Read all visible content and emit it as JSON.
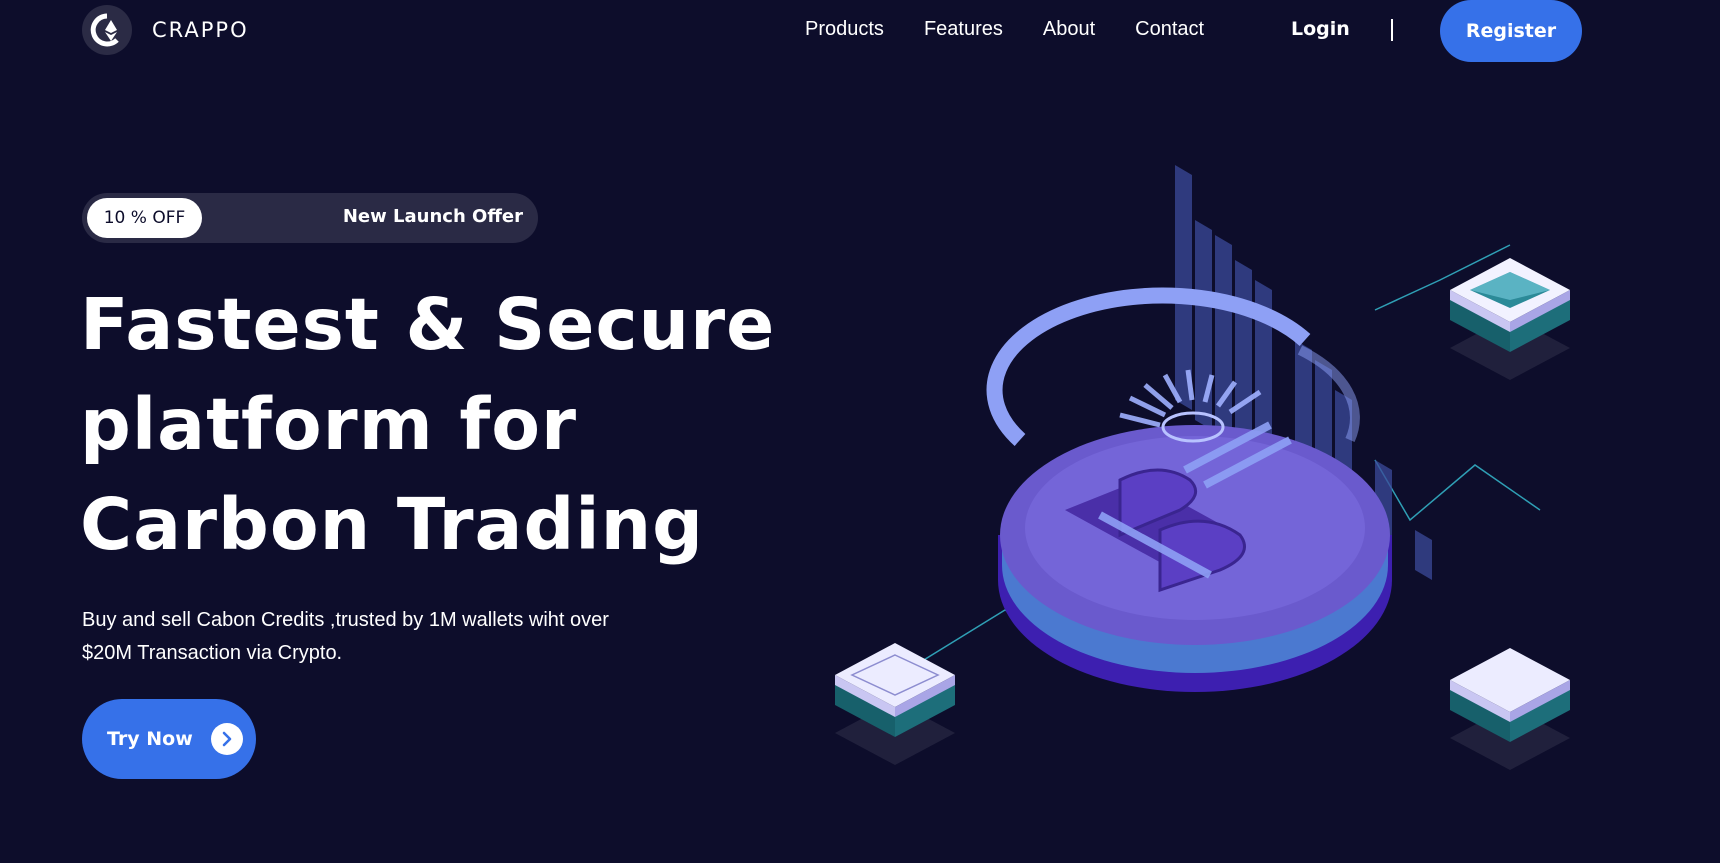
{
  "brand": {
    "name": "CRAPPO",
    "logo_icon": "ethereum-logo-icon"
  },
  "nav": {
    "links": [
      "Products",
      "Features",
      "About",
      "Contact"
    ],
    "login_label": "Login",
    "register_label": "Register"
  },
  "hero": {
    "offer_badge": "10 % OFF",
    "offer_text": "New Launch Offer",
    "title_lines": [
      "Fastest & Secure",
      "platform for",
      "Carbon Trading"
    ],
    "subtitle_lines": [
      "Buy and sell Cabon Credits ,trusted by 1M wallets wiht over",
      "$20M Transaction via Crypto."
    ],
    "cta_label": "Try Now",
    "cta_icon": "chevron-right-icon"
  },
  "colors": {
    "background": "#0d0d2b",
    "accent": "#3671e9",
    "pill": "#2a2a45"
  }
}
